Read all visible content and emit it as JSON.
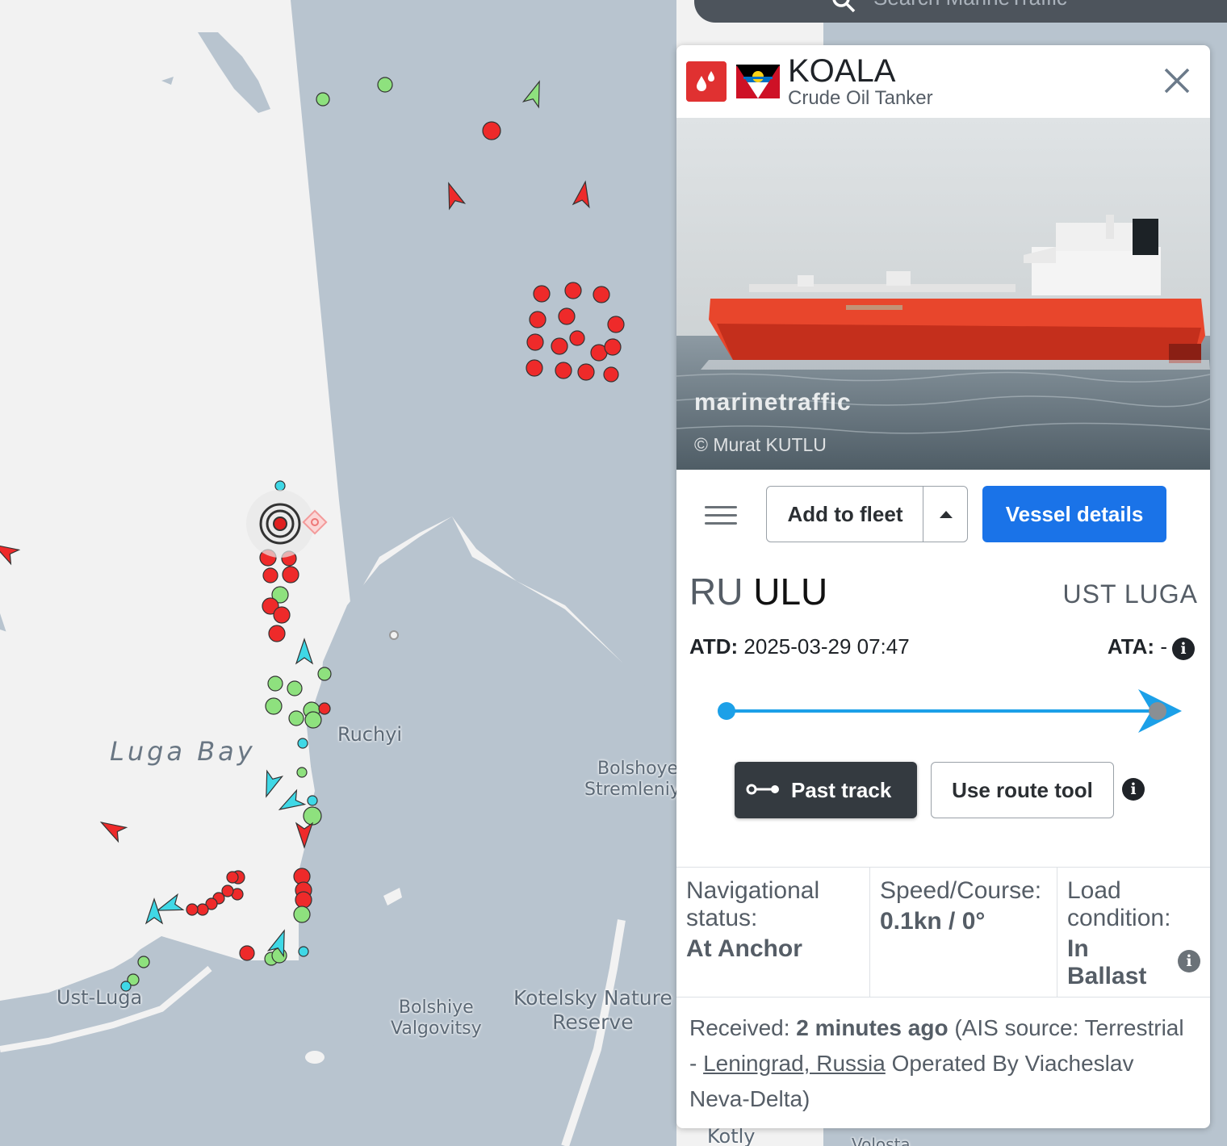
{
  "search": {
    "placeholder": "Search MarineTraffic"
  },
  "map": {
    "places": {
      "ruchyi": "Ruchyi",
      "luga_bay": "Luga Bay",
      "bolshoye_1": "Bolshoye",
      "bolshoye_2": "Stremleniye",
      "ust_luga": "Ust-Luga",
      "bolshiye_1": "Bolshiye",
      "bolshiye_2": "Valgovitsy",
      "kotelsky_1": "Kotelsky Nature",
      "kotelsky_2": "Reserve",
      "kotly": "Kotly",
      "volosovo": "Volosta"
    },
    "marker_colors": {
      "tanker": "#ee2a2a",
      "cargo": "#8ee17e",
      "passenger": "#3fd8e6",
      "unknown": "#bdbdbd"
    }
  },
  "vessel": {
    "name": "KOALA",
    "type": "Crude Oil Tanker",
    "flag": "Antigua and Barbuda",
    "type_icon": "oil-drop-icon",
    "photo": {
      "watermark": "marinetraffic",
      "credit": "© Murat KUTLU"
    }
  },
  "actions": {
    "add_to_fleet": "Add to fleet",
    "vessel_details": "Vessel details"
  },
  "voyage": {
    "from_country": "RU",
    "from_code": "ULU",
    "to_port": "UST LUGA",
    "atd_label": "ATD:",
    "atd_value": "2025-03-29 07:47",
    "ata_label": "ATA:",
    "ata_value": "-",
    "progress": 1.0
  },
  "tools": {
    "past_track": "Past track",
    "route_tool": "Use route tool"
  },
  "status": {
    "nav_label": "Navigational status:",
    "nav_value": "At Anchor",
    "speed_label": "Speed/Course:",
    "speed_value": "0.1kn / 0°",
    "load_label": "Load condition:",
    "load_value": "In Ballast"
  },
  "received": {
    "prefix": "Received:",
    "time": "2 minutes ago",
    "source_prefix": "(AIS source: Terrestrial -",
    "source_link": "Leningrad, Russia",
    "operator": "Operated By Viacheslav Neva-Delta)"
  }
}
